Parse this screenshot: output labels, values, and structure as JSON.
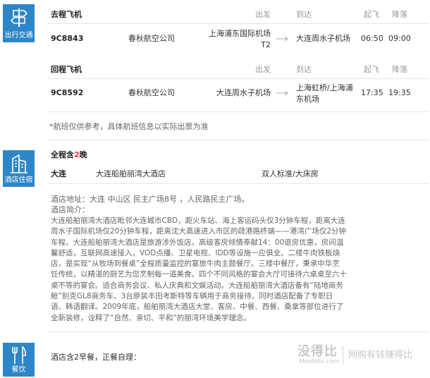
{
  "sidebar": {
    "flight_label": "出行交通",
    "hotel_label": "酒店住宿",
    "meal_label": "餐饮"
  },
  "outbound": {
    "heading": "去程飞机",
    "col_depart": "出发",
    "col_arrive": "到达",
    "col_takeoff": "起飞",
    "col_land": "降落",
    "flight_no": "9C8843",
    "airline": "春秋航空公司",
    "depart_line1": "上海浦东国际机场",
    "depart_line2": "T2",
    "arrive": "大连周水子机场",
    "takeoff": "06:50",
    "land": "09:00"
  },
  "return": {
    "heading": "回程飞机",
    "col_depart": "出发",
    "col_arrive": "到达",
    "col_takeoff": "起飞",
    "col_land": "降落",
    "flight_no": "9C8592",
    "airline": "春秋航空公司",
    "depart": "大连周水子机场",
    "arrive_line1": "上海虹桥/上海浦",
    "arrive_line2": "东机场",
    "takeoff": "17:35",
    "land": "19:35"
  },
  "flight_note": "*航班仅供参考，具体航班信息以实际出票为准",
  "hotel": {
    "stay_prefix": "全程含",
    "stay_nights": "2",
    "stay_suffix": "晚",
    "city": "大连",
    "name": "大连船舶丽湾大酒店",
    "room": "双人标准/大床房",
    "address": "酒店地址：大连 中山区 民主广场8号 ，人民路民主广场。",
    "intro_label": "酒店简介：",
    "intro_lines": [
      "大连船舶丽湾大酒店毗邻大连城市CBD，距火车站、海上客运码头仅3分钟车程，距离大连",
      "周水子国际机场仅20分钟车程，距离沈大高速进入市区的疏港路终端——港湾广场仅2分钟",
      "车程。大连船舶丽湾大酒店是旅游涉外饭店。高级客房倾情奉献14：00退房优惠，房间温",
      "馨舒适，互联网高速接入，VOD点播、卫星电视、IDD等设施一应俱全。二楼牛肉铁板烧",
      "店，是实现“从牧场到餐桌”全程质量监控的宴旅牛肉主题餐厅。三楼中餐厅，秉承中华烹",
      "饪传统，以精湛的厨艺为您烹制每一道美食。四个不同风格的宴会大厅可接待六桌桌至六十",
      "桌不等的宴会。适合商务会议、私人庆典和文娱活动。大连船舶丽湾大酒店备有“陆地商务",
      "舱”别克GL8商务车、3台原装丰田考斯特等车辆用于商务接待。同时酒店配备了专职日",
      "语、韩语翻译。2009年底，船舶丽湾大酒店大堂、客房、中餐、西餐、桑拿等部位进行了",
      "全新装修，诠释了“自然、亲切、平和”的丽湾环境美学理念。"
    ]
  },
  "meal": {
    "text": "酒店含2早餐，正餐自理："
  },
  "watermark": {
    "brand": "没得比",
    "domain": "Meidebi.com",
    "slogan": "网购有钱赚得比"
  }
}
